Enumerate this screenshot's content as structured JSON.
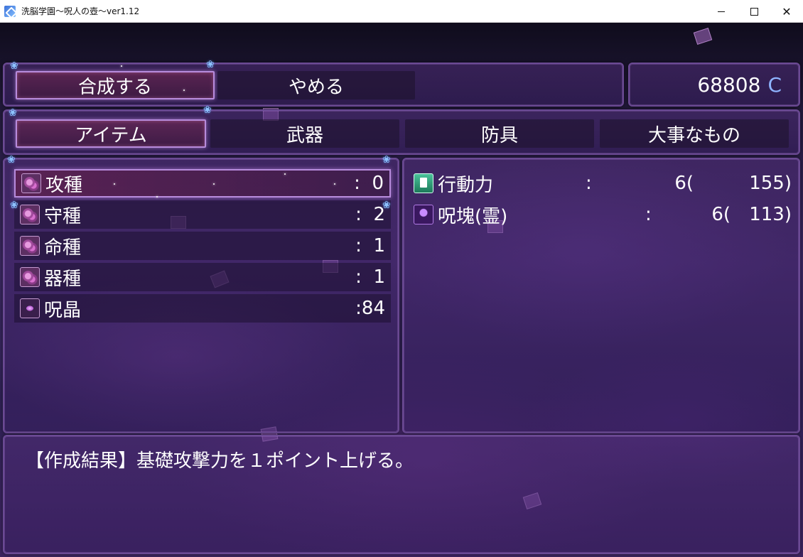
{
  "window": {
    "title": "洗脳学園～呪人の壺～ver1.12",
    "minimize": "",
    "maximize": "",
    "close": "✕"
  },
  "commands": {
    "synthesize": "合成する",
    "cancel": "やめる"
  },
  "gold": {
    "amount": "68808",
    "unit": "C"
  },
  "categories": [
    "アイテム",
    "武器",
    "防具",
    "大事なもの"
  ],
  "items": [
    {
      "name": "攻種",
      "count": ":  0"
    },
    {
      "name": "守種",
      "count": ":  2"
    },
    {
      "name": "命種",
      "count": ":  1"
    },
    {
      "name": "器種",
      "count": ":  1"
    },
    {
      "name": "呪晶",
      "count": ":84"
    }
  ],
  "requirements": [
    {
      "name": "行動力",
      "colon": ":",
      "value": "6(",
      "total": "155)"
    },
    {
      "name": "呪塊(霊)",
      "colon": ":",
      "value": "6(",
      "total": "113)"
    }
  ],
  "help": {
    "text": "【作成結果】基礎攻撃力を１ポイント上げる。"
  },
  "colors": {
    "accent": "#b78bdc",
    "gold_unit": "#8fb4ff",
    "panel_border": "#6b4a94"
  }
}
